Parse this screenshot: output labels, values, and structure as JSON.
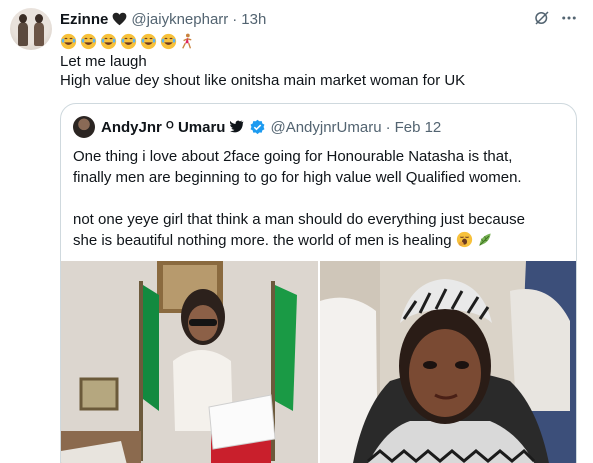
{
  "tweet": {
    "author_name": "Ezinne",
    "author_heart": "🖤",
    "handle": "@jaiyknepharr",
    "separator": "·",
    "time": "13h",
    "emoji_line": "😂😂😂😂😂😂🏃‍♀️",
    "text_line_1": "Let me laugh",
    "text_line_2": "High value dey shout like onitsha main market woman for UK"
  },
  "quoted": {
    "author_name": "AndyJnr ᴼ Umaru",
    "handle": "@AndyjnrUmaru",
    "separator": "·",
    "date": "Feb 12",
    "line_1": "One thing i love about 2face going for Honourable Natasha is that,",
    "line_2": "finally men are beginning to go for high value well Qualified women.",
    "line_3": "not one yeye girl that think a man should do everything just because",
    "line_4": "she is beautiful nothing more. the world of men is healing"
  },
  "colors": {
    "text_primary": "#0f1419",
    "text_secondary": "#536471",
    "verified_blue": "#1d9bf0",
    "border": "#cfd9de"
  },
  "icons": [
    "black-heart-icon",
    "grok-icon",
    "more-options-icon",
    "verified-badge-icon",
    "bird-icon",
    "face-with-tears-of-joy-icon",
    "woman-running-icon",
    "yawning-face-icon",
    "herb-leaf-icon"
  ]
}
